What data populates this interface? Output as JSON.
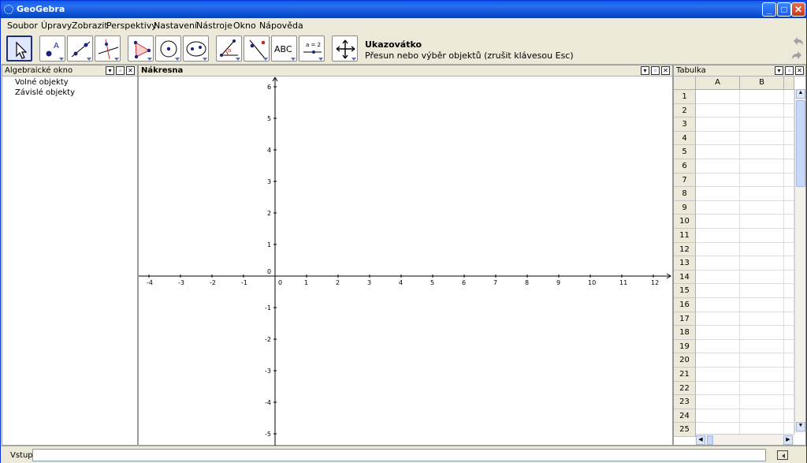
{
  "window": {
    "title": "GeoGebra"
  },
  "menu": [
    "Soubor",
    "Úpravy",
    "Zobrazit",
    "Perspektivy",
    "Nastavení",
    "Nástroje",
    "Okno",
    "Nápověda"
  ],
  "toolbar": {
    "tool_name": "Ukazovátko",
    "tool_help": "Přesun nebo výběr objektů (zrušit klávesou Esc)",
    "text_tool_label": "ABC",
    "slider_tool_label": "a = 2",
    "tools": [
      "move-tool",
      "point-tool",
      "line-tool",
      "perpendicular-tool",
      "polygon-tool",
      "circle-tool",
      "conic-tool",
      "angle-tool",
      "reflect-tool",
      "text-tool",
      "slider-tool",
      "move-view-tool"
    ]
  },
  "algebra": {
    "title": "Algebraické okno",
    "items": [
      "Volné objekty",
      "Závislé objekty"
    ]
  },
  "graphics": {
    "title": "Nákresna",
    "x_ticks": [
      "-4",
      "-3",
      "-2",
      "-1",
      "0",
      "1",
      "2",
      "3",
      "4",
      "5",
      "6",
      "7",
      "8",
      "9",
      "10",
      "11",
      "12"
    ],
    "y_ticks": [
      "6",
      "5",
      "4",
      "3",
      "2",
      "1",
      "0",
      "-1",
      "-2",
      "-3",
      "-4",
      "-5"
    ]
  },
  "spreadsheet": {
    "title": "Tabulka",
    "columns": [
      "A",
      "B"
    ],
    "rows": [
      "1",
      "2",
      "3",
      "4",
      "5",
      "6",
      "7",
      "8",
      "9",
      "10",
      "11",
      "12",
      "13",
      "14",
      "15",
      "16",
      "17",
      "18",
      "19",
      "20",
      "21",
      "22",
      "23",
      "24",
      "25"
    ]
  },
  "input": {
    "label": "Vstup:",
    "value": ""
  },
  "colors": {
    "titlebar": "#0a5fe8",
    "axis": "#000000",
    "point": "#1a237e",
    "accent_red": "#c62828"
  }
}
